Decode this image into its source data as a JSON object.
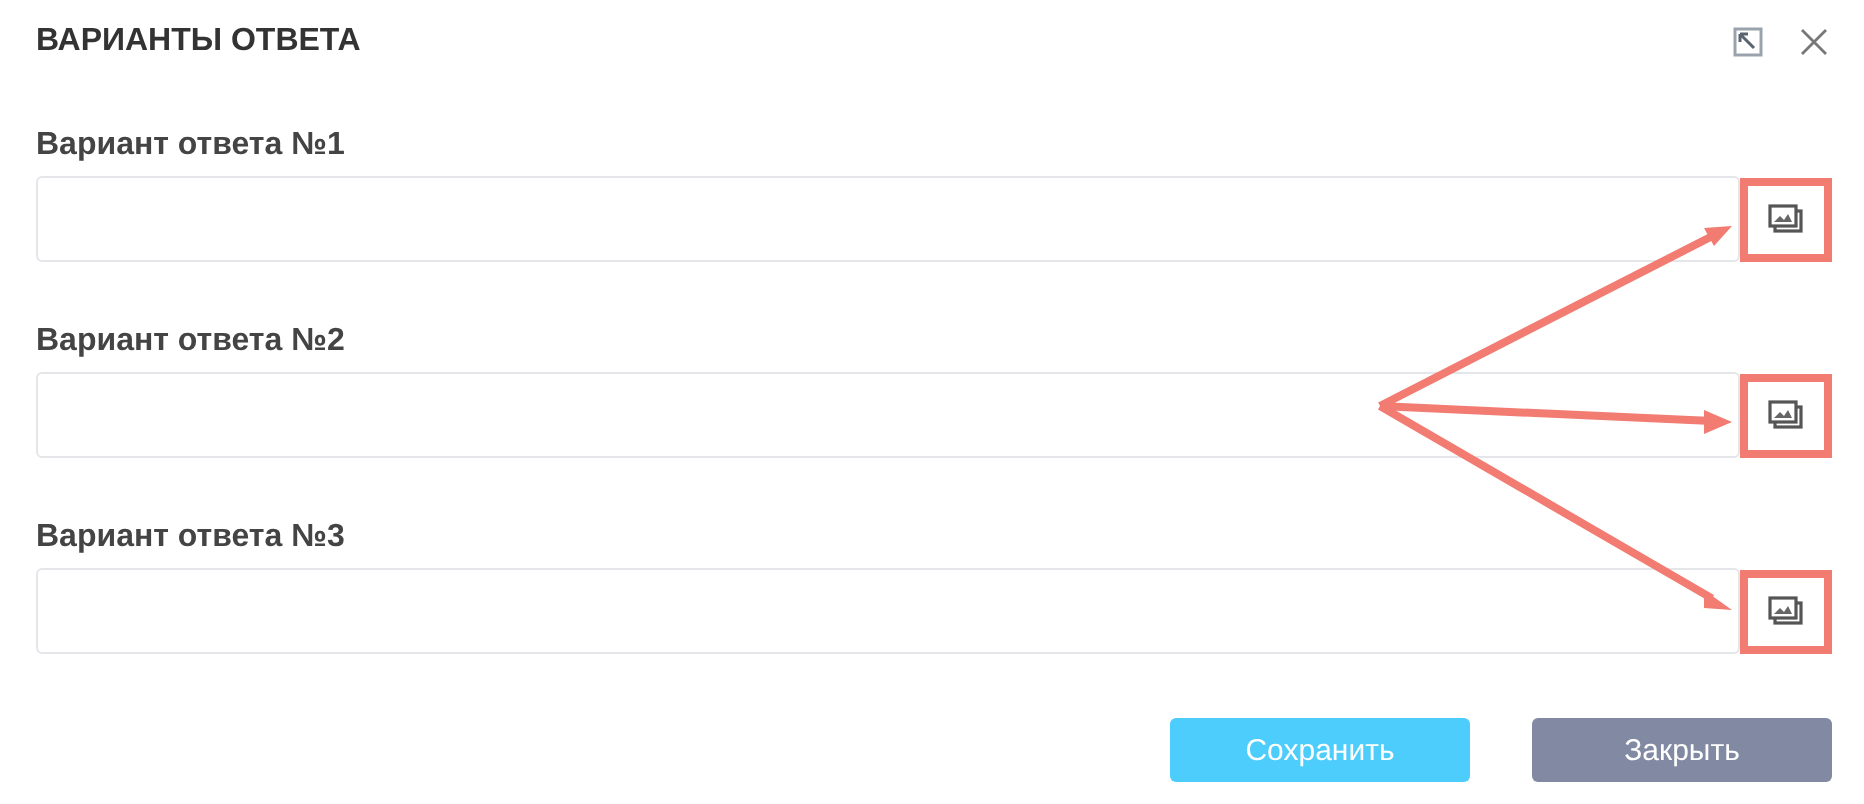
{
  "dialog": {
    "title": "ВАРИАНТЫ ОТВЕТА"
  },
  "fields": [
    {
      "label": "Вариант ответа №1",
      "highlighted": true
    },
    {
      "label": "Вариант ответа №2",
      "highlighted": true
    },
    {
      "label": "Вариант ответа №3",
      "highlighted": true
    }
  ],
  "buttons": [
    {
      "label": "Сохранить",
      "kind": "primary"
    },
    {
      "label": "Закрыть",
      "kind": "secondary"
    }
  ]
}
